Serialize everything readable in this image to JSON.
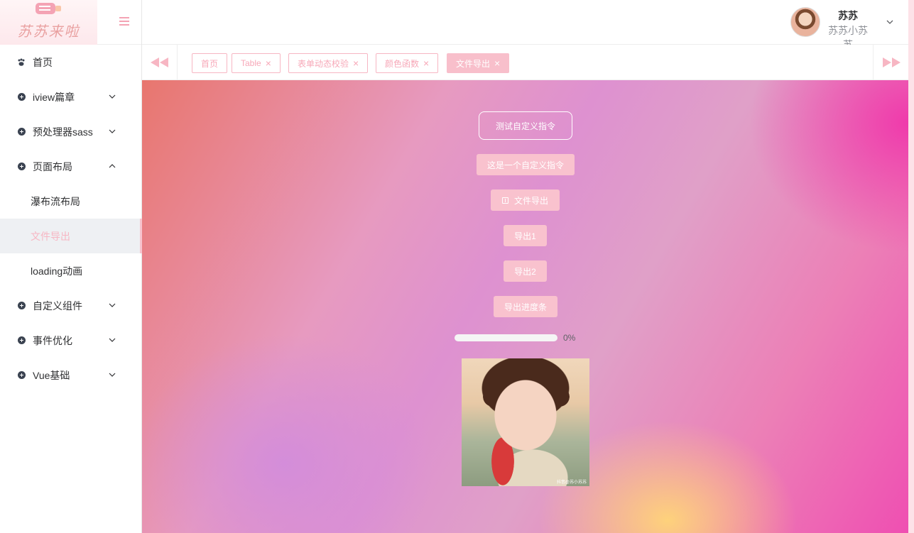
{
  "app": {
    "logo_text": "苏苏来啦"
  },
  "user": {
    "name": "苏苏",
    "subtitle": "苏苏小苏苏"
  },
  "sidebar": {
    "items": [
      {
        "label": "首页",
        "icon": "paw-icon"
      },
      {
        "label": "iview篇章",
        "icon": "plus-circle-icon",
        "expandable": true,
        "expanded": false
      },
      {
        "label": "预处理器sass",
        "icon": "plus-circle-icon",
        "expandable": true,
        "expanded": false
      },
      {
        "label": "页面布局",
        "icon": "plus-circle-icon",
        "expandable": true,
        "expanded": true,
        "children": [
          {
            "label": "瀑布流布局",
            "active": false
          },
          {
            "label": "文件导出",
            "active": true
          },
          {
            "label": "loading动画",
            "active": false
          }
        ]
      },
      {
        "label": "自定义组件",
        "icon": "plus-circle-icon",
        "expandable": true,
        "expanded": false
      },
      {
        "label": "事件优化",
        "icon": "plus-circle-icon",
        "expandable": true,
        "expanded": false
      },
      {
        "label": "Vue基础",
        "icon": "plus-circle-icon",
        "expandable": true,
        "expanded": false
      }
    ]
  },
  "tabs": [
    {
      "label": "首页",
      "closable": false,
      "active": false
    },
    {
      "label": "Table",
      "closable": true,
      "active": false
    },
    {
      "label": "表单动态校验",
      "closable": true,
      "active": false
    },
    {
      "label": "颜色函数",
      "closable": true,
      "active": false
    },
    {
      "label": "文件导出",
      "closable": true,
      "active": true
    }
  ],
  "main": {
    "buttons": {
      "test_directive": "测试自定义指令",
      "custom_directive": "这是一个自定义指令",
      "file_export": "文件导出",
      "export1": "导出1",
      "export2": "导出2",
      "export_progress": "导出进度条"
    },
    "progress": {
      "percent": 0,
      "label": "0%"
    },
    "photo_caption": "抖音@苏小苏苏"
  },
  "colors": {
    "accent": "#f7b6c3",
    "active_tab_bg": "#f8bfcb",
    "button_bg": "#f9c2ce"
  }
}
